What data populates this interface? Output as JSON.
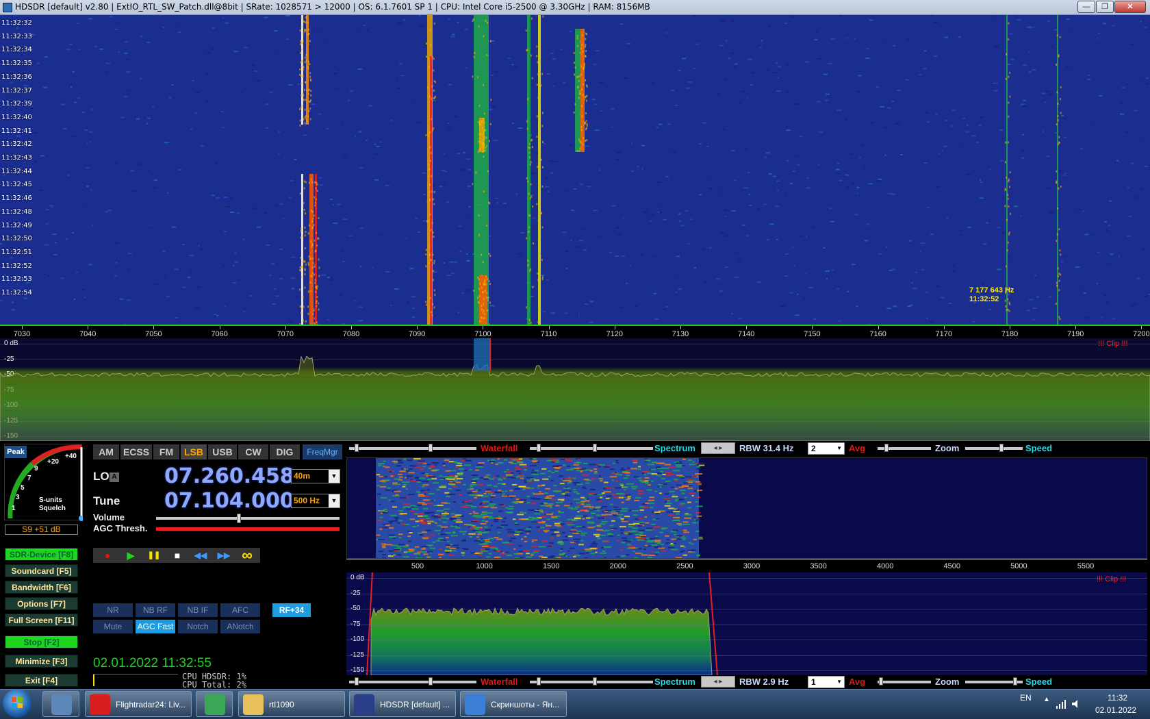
{
  "window": {
    "title": "HDSDR  [default]  v2.80   |   ExtIO_RTL_SW_Patch.dll@8bit   |   SRate: 1028571 > 12000   |   OS: 6.1.7601 SP 1   |   CPU: Intel Core i5-2500 @ 3.30GHz   |   RAM: 8156MB",
    "minimize": "—",
    "restore": "❐",
    "close": "✕"
  },
  "waterfall_main": {
    "timestamps": [
      "11:32:32",
      "11:32:33",
      "11:32:34",
      "11:32:35",
      "11:32:36",
      "11:32:37",
      "11:32:39",
      "11:32:40",
      "11:32:41",
      "11:32:42",
      "11:32:43",
      "11:32:44",
      "11:32:45",
      "11:32:46",
      "11:32:48",
      "11:32:49",
      "11:32:50",
      "11:32:51",
      "11:32:52",
      "11:32:53",
      "11:32:54"
    ],
    "cursor_freq": "7 177 643 Hz",
    "cursor_time": "11:32:52"
  },
  "freq_axis": {
    "ticks": [
      "7030",
      "7040",
      "7050",
      "7060",
      "7070",
      "7080",
      "7090",
      "7100",
      "7110",
      "7120",
      "7130",
      "7140",
      "7150",
      "7160",
      "7170",
      "7180",
      "7190",
      "7200"
    ]
  },
  "spectrum_main": {
    "db_labels": [
      "0 dB",
      "-25",
      "-50",
      "-75",
      "-100",
      "-125",
      "-150"
    ],
    "clip": "!!! Clip !!!"
  },
  "smeter": {
    "peak": "Peak",
    "scale": [
      "+40",
      "+20",
      "9",
      "7",
      "5",
      "3",
      "1"
    ],
    "units": "S-units",
    "squelch": "Squelch",
    "reading": "S9 +51 dB"
  },
  "left_buttons": [
    {
      "label": "SDR-Device [F8]",
      "green": true
    },
    {
      "label": "Soundcard  [F5]",
      "green": false
    },
    {
      "label": "Bandwidth  [F6]",
      "green": false
    },
    {
      "label": "Options    [F7]",
      "green": false
    },
    {
      "label": "Full Screen  [F11]",
      "green": false
    },
    {
      "label": "Stop       [F2]",
      "green": true
    },
    {
      "label": "Minimize   [F3]",
      "green": false
    },
    {
      "label": "Exit       [F4]",
      "green": false
    }
  ],
  "modes": [
    "AM",
    "ECSS",
    "FM",
    "LSB",
    "USB",
    "CW",
    "DIG"
  ],
  "active_mode": "LSB",
  "freqmgr": "FreqMgr",
  "lo": {
    "label": "LO",
    "badge": "A",
    "value": "07.260.458",
    "band": "40m"
  },
  "tune": {
    "label": "Tune",
    "value": "07.104.000",
    "step": "500 Hz"
  },
  "volume_label": "Volume",
  "agc_label": "AGC Thresh.",
  "volume_level": 0.45,
  "agc_level": 1.0,
  "transport": {
    "record": "●",
    "play": "▶",
    "pause": "❚❚",
    "stop": "■",
    "rewind": "◀◀",
    "forward": "▶▶",
    "loop": "∞"
  },
  "filter_row1": [
    "NR",
    "NB RF",
    "NB IF",
    "AFC"
  ],
  "filter_row2": [
    "Mute",
    "AGC Fast",
    "Notch",
    "ANotch"
  ],
  "rf_button": "RF+34",
  "datetime": "02.01.2022 11:32:55",
  "cpu": {
    "hdsdr": "CPU HDSDR:  1%",
    "total": "CPU Total:  2%"
  },
  "ctrlbar_top": {
    "waterfall": "Waterfall",
    "spectrum": "Spectrum",
    "rbw": "RBW 31.4 Hz",
    "avg_val": "2",
    "avg": "Avg",
    "zoom": "Zoom",
    "speed": "Speed"
  },
  "ctrlbar_bottom": {
    "waterfall": "Waterfall",
    "spectrum": "Spectrum",
    "rbw": "RBW  2.9 Hz",
    "avg_val": "1",
    "avg": "Avg",
    "zoom": "Zoom",
    "speed": "Speed"
  },
  "audio_axis": {
    "ticks": [
      "500",
      "1000",
      "1500",
      "2000",
      "2500",
      "3000",
      "3500",
      "4000",
      "4500",
      "5000",
      "5500"
    ]
  },
  "audio_spectrum": {
    "db_labels": [
      "0 dB",
      "-25",
      "-50",
      "-75",
      "-100",
      "-125",
      "-150"
    ],
    "clip": "!!! Clip !!!"
  },
  "taskbar": {
    "items": [
      {
        "label": "",
        "icon": "calculator-icon",
        "color": "#5d87b8",
        "pinned": true
      },
      {
        "label": "Flightradar24: Liv...",
        "icon": "opera-icon",
        "color": "#d81e1e",
        "pinned": false
      },
      {
        "label": "",
        "icon": "chrome-icon",
        "color": "#3aa757",
        "pinned": true
      },
      {
        "label": "rtl1090",
        "icon": "folder-icon",
        "color": "#e8c05a",
        "pinned": false
      },
      {
        "label": "HDSDR  [default] ...",
        "icon": "hdsdr-icon",
        "color": "#2a3e8a",
        "pinned": false
      },
      {
        "label": "Скриншоты - Ян...",
        "icon": "browser-icon",
        "color": "#3b7fd6",
        "pinned": false
      }
    ],
    "lang": "EN",
    "time": "11:32",
    "date": "02.01.2022"
  }
}
